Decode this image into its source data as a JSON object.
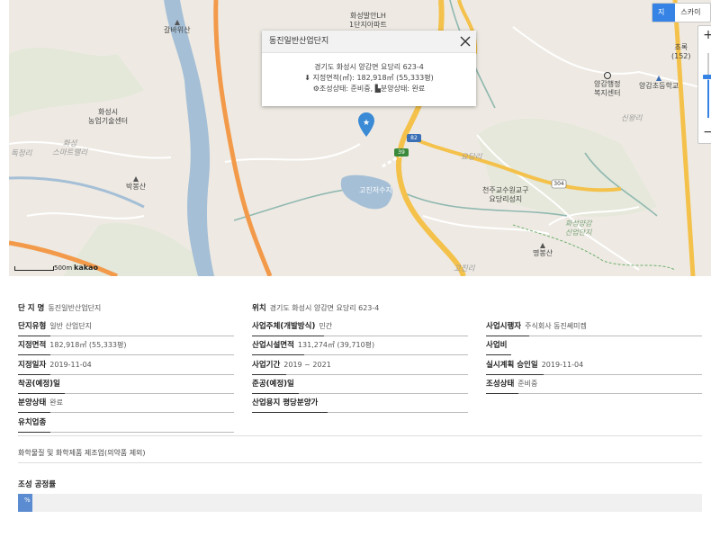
{
  "map": {
    "labels": {
      "apartment": "화성발안LH\n1단지아파트",
      "galbawisan": "갈바위산",
      "agri_center": "화성시\n농업기술센터",
      "smart_valley": "화성\n스마트밸리",
      "dokjeong": "독정리",
      "bakbongsan": "박봉산",
      "gojin": "고진저수지",
      "yodangri": "요당리",
      "church": "천주교수원교구\n요당리성지",
      "industrial_park": "화성양감\n산업단지",
      "myeongbongsan": "명봉산",
      "welfare": "양감행정\n복지센터",
      "school": "양감초등학교",
      "sinwangri": "신왕리",
      "chorok": "초록\n(152)",
      "gojinri": "고진리",
      "route82": "82",
      "route39": "39",
      "route304": "304"
    },
    "view_toggle": {
      "map": "지도",
      "skyview": "스카이뷰"
    },
    "zoom": {
      "plus": "+",
      "minus": "−",
      "level": 0.58
    },
    "scale": {
      "label": "500m",
      "logo": "kakao"
    },
    "popup": {
      "title": "동진일반산업단지",
      "address": "경기도 화성시 양감면 요당리 623-4",
      "area": "지정면적(㎡):  182,918㎡ (55,333평)",
      "status": "조성상태:  준비중,",
      "sale": "분양상태:  완료"
    }
  },
  "info": {
    "name": {
      "label": "단 지 명",
      "value": "동진일반산업단지"
    },
    "location": {
      "label": "위치",
      "value": "경기도 화성시 양감면 요당리 623-4"
    },
    "type": {
      "label": "단지유형",
      "value": "일반 산업단지"
    },
    "operator_type": {
      "label": "사업주체(개발방식)",
      "value": "민간"
    },
    "operator": {
      "label": "사업시행자",
      "value": "주식회사 동진쎄미켐"
    },
    "area": {
      "label": "지정면적",
      "value": "182,918㎡ (55,333평)"
    },
    "facility_area": {
      "label": "산업시설면적",
      "value": "131,274㎡ (39,710평)"
    },
    "cost": {
      "label": "사업비",
      "value": ""
    },
    "designated_date": {
      "label": "지정일자",
      "value": "2019-11-04"
    },
    "period": {
      "label": "사업기간",
      "value": "2019 ~ 2021"
    },
    "plan_approval": {
      "label": "실시계획 승인일",
      "value": "2019-11-04"
    },
    "start": {
      "label": "착공(예정)일",
      "value": ""
    },
    "completion": {
      "label": "준공(예정)일",
      "value": ""
    },
    "status": {
      "label": "조성상태",
      "value": "준비중"
    },
    "sale_status": {
      "label": "분양상태",
      "value": "완료"
    },
    "price": {
      "label": "산업용지 평당분양가",
      "value": ""
    },
    "industries": {
      "label": "유치업종",
      "value": ""
    }
  },
  "industry_desc": "화학물질 및 화학제품 제조업(의약품 제외)",
  "progress": {
    "title": "조성 공정률",
    "text": "%",
    "value": 0.02
  },
  "colors": {
    "accent": "#3583e5",
    "progress": "#5b8bd0",
    "highway": "#f4c14b",
    "expressway": "#f29a4a",
    "river": "#a5bfd6"
  }
}
